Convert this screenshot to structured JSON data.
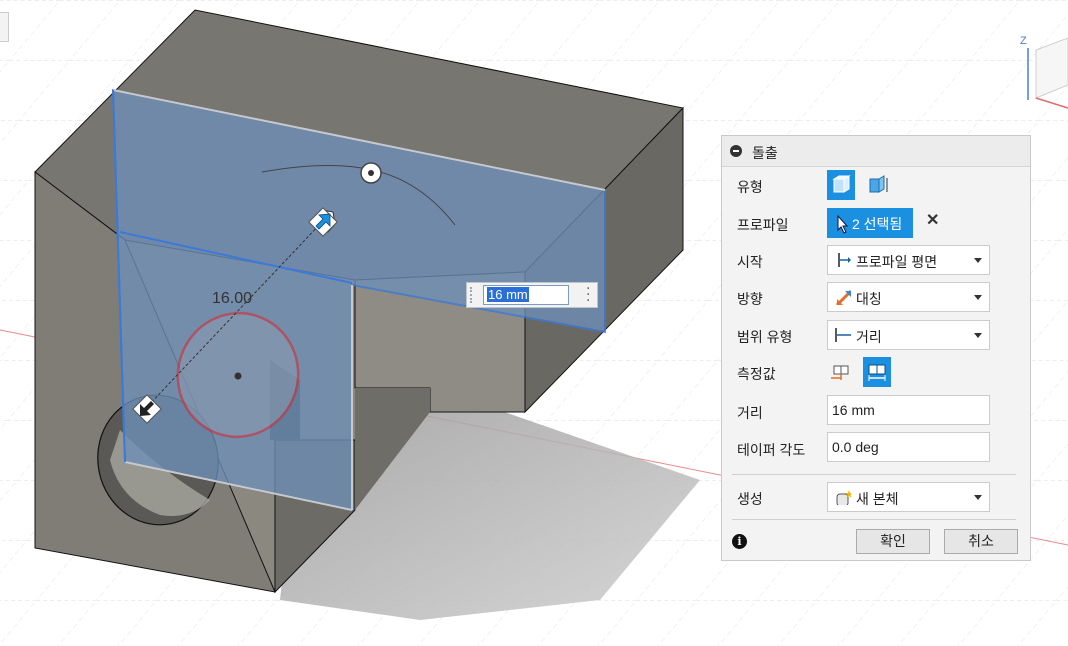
{
  "viewport": {
    "dimension_value": "16.00",
    "inline_value": "16 mm",
    "viewcube_axis": "Z"
  },
  "dialog": {
    "title": "돌출",
    "rows": {
      "type_label": "유형",
      "profile_label": "프로파일",
      "profile_selection": "2 선택됨",
      "start_label": "시작",
      "start_value": "프로파일 평면",
      "direction_label": "방향",
      "direction_value": "대칭",
      "extent_type_label": "범위 유형",
      "extent_type_value": "거리",
      "measurement_label": "측정값",
      "distance_label": "거리",
      "distance_value": "16 mm",
      "taper_label": "테이퍼 각도",
      "taper_value": "0.0 deg",
      "operation_label": "생성",
      "operation_value": "새 본체"
    },
    "ok_label": "확인",
    "cancel_label": "취소"
  },
  "colors": {
    "accent": "#1b8fe0",
    "solid_face": "#7d7b73",
    "profile_fill": "#6e8fb8",
    "profile_edge": "#3b7ad6",
    "circle_edge": "#d9262c"
  }
}
